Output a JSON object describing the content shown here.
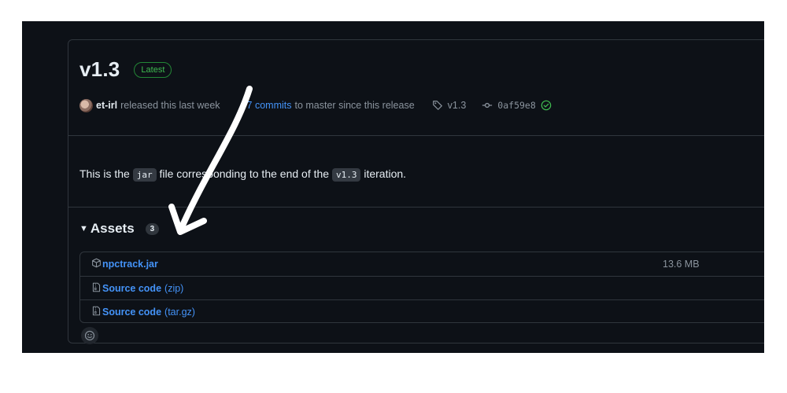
{
  "release": {
    "title": "v1.3",
    "badge": "Latest"
  },
  "meta": {
    "author": "et-irl",
    "released_text": "released this last week",
    "commits_link": "7 commits",
    "commits_text": "to master since this release",
    "tag": "v1.3",
    "commit_sha": "0af59e8"
  },
  "description": {
    "part1": "This is the",
    "code1": "jar",
    "part2": "file corresponding to the end of the",
    "code2": "v1.3",
    "part3": "iteration."
  },
  "assets": {
    "title": "Assets",
    "count": "3",
    "items": [
      {
        "name": "npctrack.jar",
        "suffix": "",
        "size": "13.6 MB",
        "icon": "package-icon"
      },
      {
        "name": "Source code",
        "suffix": "(zip)",
        "size": "",
        "icon": "file-zip-icon"
      },
      {
        "name": "Source code",
        "suffix": "(tar.gz)",
        "size": "",
        "icon": "file-zip-icon"
      }
    ]
  },
  "colors": {
    "background": "#0d1117",
    "border": "#30363d",
    "link": "#4493f8",
    "success": "#3fb950",
    "muted": "#8b949e"
  }
}
